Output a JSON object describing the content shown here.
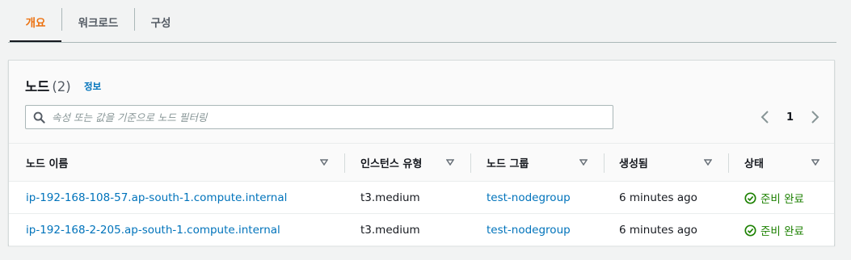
{
  "tabs": [
    {
      "label": "개요",
      "active": true
    },
    {
      "label": "워크로드",
      "active": false
    },
    {
      "label": "구성",
      "active": false
    }
  ],
  "panel": {
    "title": "노드",
    "count": "(2)",
    "info_link": "정보"
  },
  "search": {
    "placeholder": "속성 또는 값을 기준으로 노드 필터링",
    "value": ""
  },
  "pagination": {
    "current_page": "1"
  },
  "table": {
    "columns": [
      "노드 이름",
      "인스턴스 유형",
      "노드 그룹",
      "생성됨",
      "상태"
    ],
    "rows": [
      {
        "name": "ip-192-168-108-57.ap-south-1.compute.internal",
        "instance_type": "t3.medium",
        "node_group": "test-nodegroup",
        "created": "6 minutes ago",
        "status": "준비 완료"
      },
      {
        "name": "ip-192-168-2-205.ap-south-1.compute.internal",
        "instance_type": "t3.medium",
        "node_group": "test-nodegroup",
        "created": "6 minutes ago",
        "status": "준비 완료"
      }
    ]
  },
  "colors": {
    "active_tab": "#ec7211",
    "link": "#0073bb",
    "status_success": "#1d8102"
  },
  "icons": [
    "search-icon",
    "chevron-left-icon",
    "chevron-right-icon",
    "sort-caret-icon",
    "status-check-icon"
  ]
}
